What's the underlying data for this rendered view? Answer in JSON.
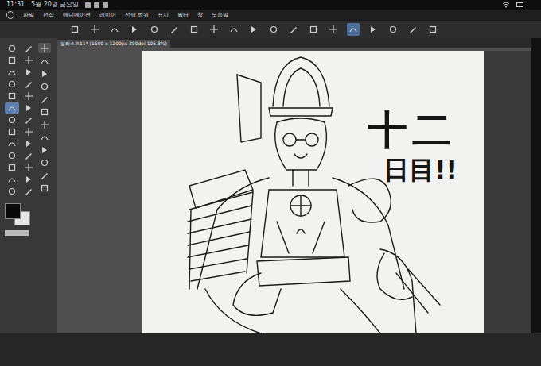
{
  "status_bar": {
    "time": "11:31",
    "date": "5월 20일 금요일"
  },
  "menu": [
    "파일",
    "편집",
    "애니메이션",
    "레이어",
    "선택 범위",
    "표시",
    "필터",
    "창",
    "도움말"
  ],
  "command_bar": [
    {
      "selected": false
    },
    {
      "selected": false
    },
    {
      "selected": false
    },
    {
      "selected": false
    },
    {
      "selected": false
    },
    {
      "selected": false
    },
    {
      "selected": false
    },
    {
      "selected": false
    },
    {
      "selected": false
    },
    {
      "selected": false
    },
    {
      "selected": false
    },
    {
      "selected": false
    },
    {
      "selected": false
    },
    {
      "selected": false
    },
    {
      "selected": true
    },
    {
      "selected": false
    },
    {
      "selected": false
    },
    {
      "selected": false
    },
    {
      "selected": false
    }
  ],
  "document_tab": {
    "label": "일러스트11* (1600 x 1200px 300dpi 105.8%)",
    "selected": true
  },
  "tools": [
    {
      "selected": false
    },
    {
      "selected": false
    },
    {
      "selected": false
    },
    {
      "selected": false
    },
    {
      "selected": false
    },
    {
      "selected": false
    },
    {
      "selected": false
    },
    {
      "selected": false
    },
    {
      "selected": false
    },
    {
      "selected": false
    },
    {
      "selected": true
    },
    {
      "selected": false
    },
    {
      "selected": false
    },
    {
      "selected": false
    },
    {
      "selected": false
    },
    {
      "selected": false
    },
    {
      "selected": false
    },
    {
      "selected": false
    },
    {
      "selected": false
    },
    {
      "selected": false
    },
    {
      "selected": false
    },
    {
      "selected": false
    },
    {
      "selected": false
    },
    {
      "selected": false
    },
    {
      "selected": false
    },
    {
      "selected": false
    }
  ],
  "sub_tools": [
    {
      "selected": true
    },
    {
      "selected": false
    },
    {
      "selected": false
    },
    {
      "selected": false
    },
    {
      "selected": false
    },
    {
      "selected": false
    },
    {
      "selected": false
    },
    {
      "selected": false
    },
    {
      "selected": false
    },
    {
      "selected": false
    },
    {
      "selected": false
    },
    {
      "selected": false
    }
  ],
  "color_swatches": [
    {
      "color": "#0a0a0a"
    },
    {
      "color": "#e6e6e6"
    }
  ],
  "canvas": {
    "caption": [
      "十二",
      "日目!!"
    ]
  }
}
